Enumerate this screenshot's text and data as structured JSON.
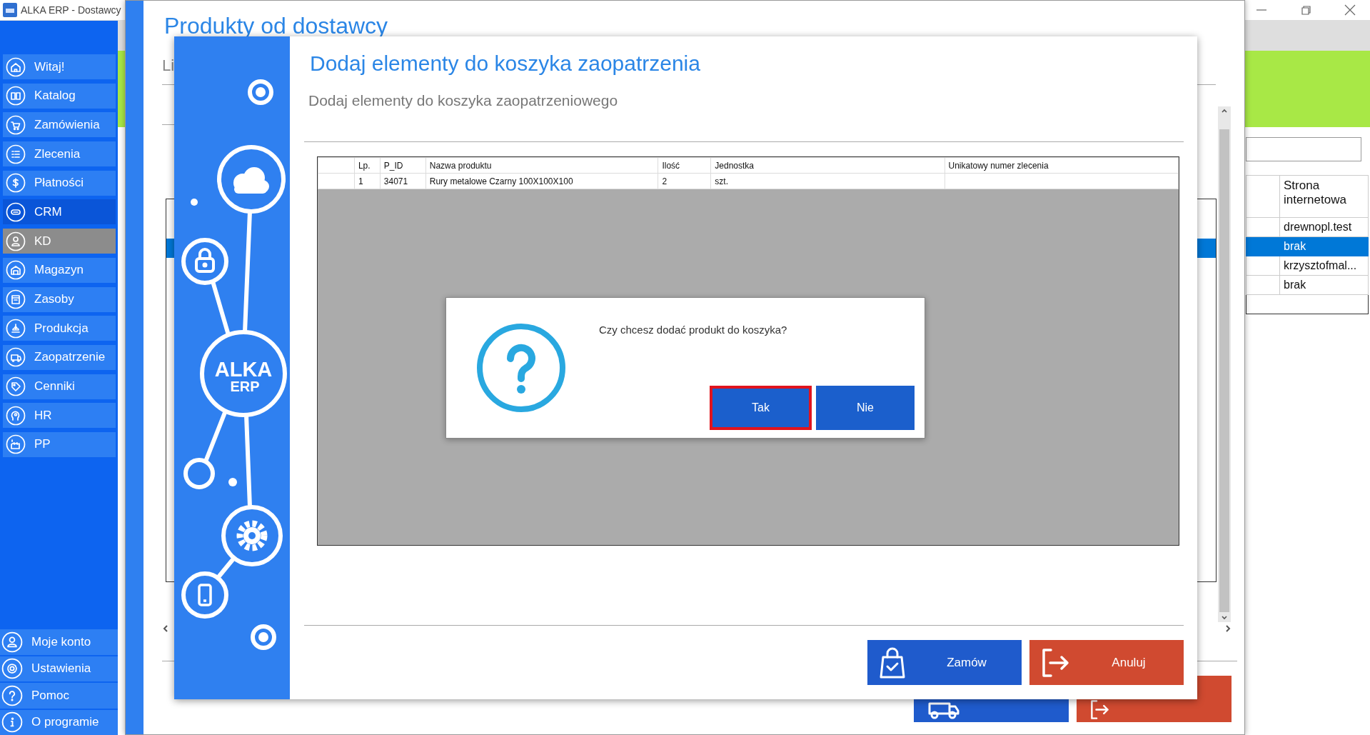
{
  "window": {
    "title": "ALKA ERP - Dostawcy"
  },
  "sidebar": {
    "items": [
      {
        "label": "Witaj!",
        "selected": false,
        "highlighted": false
      },
      {
        "label": "Katalog",
        "selected": false,
        "highlighted": false
      },
      {
        "label": "Zamówienia",
        "selected": false,
        "highlighted": false
      },
      {
        "label": "Zlecenia",
        "selected": false,
        "highlighted": false
      },
      {
        "label": "Płatności",
        "selected": false,
        "highlighted": false
      },
      {
        "label": "CRM",
        "selected": false,
        "highlighted": true
      },
      {
        "label": "KD",
        "selected": true,
        "highlighted": false
      },
      {
        "label": "Magazyn",
        "selected": false,
        "highlighted": false
      },
      {
        "label": "Zasoby",
        "selected": false,
        "highlighted": false
      },
      {
        "label": "Produkcja",
        "selected": false,
        "highlighted": false
      },
      {
        "label": "Zaopatrzenie",
        "selected": false,
        "highlighted": false
      },
      {
        "label": "Cenniki",
        "selected": false,
        "highlighted": false
      },
      {
        "label": "HR",
        "selected": false,
        "highlighted": false
      },
      {
        "label": "PP",
        "selected": false,
        "highlighted": false
      }
    ],
    "bottom_items": [
      {
        "label": "Moje konto"
      },
      {
        "label": "Ustawienia"
      },
      {
        "label": "Pomoc"
      },
      {
        "label": "O programie"
      }
    ]
  },
  "supplier_table": {
    "column_2": "Strona internetowa",
    "rows": [
      {
        "website": "drewnopl.test",
        "selected": false
      },
      {
        "website": "brak",
        "selected": true
      },
      {
        "website": "krzysztofmal...",
        "selected": false
      },
      {
        "website": "brak",
        "selected": false
      }
    ]
  },
  "back_window": {
    "title": "Produkty od dostawcy",
    "subtitle": "Li",
    "buttons": [
      {
        "kind": "primary"
      },
      {
        "kind": "cancel"
      }
    ]
  },
  "dialog": {
    "title": "Dodaj elementy do koszyka zaopatrzenia",
    "subtitle": "Dodaj elementy do koszyka zaopatrzeniowego",
    "logo": [
      "ALKA",
      "ERP"
    ],
    "table": {
      "columns": [
        "Lp.",
        "P_ID",
        "Nazwa produktu",
        "Ilość",
        "Jednostka",
        "Unikatowy numer zlecenia"
      ],
      "rows": [
        {
          "cells": [
            "1",
            "34071",
            "Rury metalowe Czarny 100X100X100",
            "2",
            "szt.",
            ""
          ]
        }
      ]
    },
    "buttons": [
      {
        "label": "Zamów",
        "kind": "primary"
      },
      {
        "label": "Anuluj",
        "kind": "cancel"
      }
    ]
  },
  "message_box": {
    "text": "Czy chcesz dodać produkt do koszyka?",
    "buttons": [
      {
        "label": "Tak",
        "focused": true
      },
      {
        "label": "Nie",
        "focused": false
      }
    ]
  }
}
